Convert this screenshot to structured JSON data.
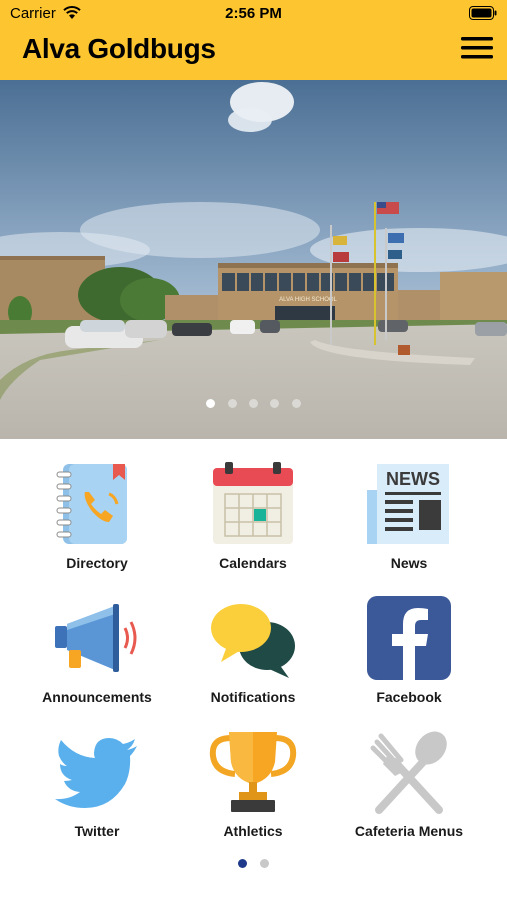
{
  "status": {
    "carrier": "Carrier",
    "time": "2:56 PM"
  },
  "header": {
    "title": "Alva Goldbugs",
    "menu_icon": "hamburger-menu-icon"
  },
  "hero": {
    "building_sign": "ALVA HIGH SCHOOL",
    "slide_count": 5,
    "active_slide": 1
  },
  "tiles": [
    {
      "label": "Directory",
      "icon": "address-book-icon"
    },
    {
      "label": "Calendars",
      "icon": "calendar-icon"
    },
    {
      "label": "News",
      "icon": "newspaper-icon"
    },
    {
      "label": "Announcements",
      "icon": "megaphone-icon"
    },
    {
      "label": "Notifications",
      "icon": "chat-bubbles-icon"
    },
    {
      "label": "Facebook",
      "icon": "facebook-icon"
    },
    {
      "label": "Twitter",
      "icon": "twitter-bird-icon"
    },
    {
      "label": "Athletics",
      "icon": "trophy-icon"
    },
    {
      "label": "Cafeteria Menus",
      "icon": "fork-spoon-icon"
    }
  ],
  "pager": {
    "page_count": 2,
    "active_page": 1
  },
  "colors": {
    "brand_yellow": "#fdc52f",
    "active_dot": "#1f3a8a",
    "inactive_dot": "#c8c8c8"
  }
}
